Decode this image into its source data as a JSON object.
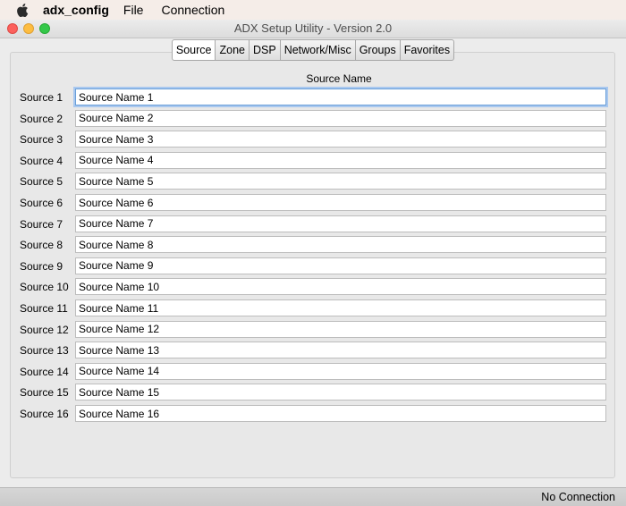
{
  "menubar": {
    "app_name": "adx_config",
    "items": [
      "File",
      "Connection"
    ]
  },
  "window": {
    "title": "ADX Setup Utility - Version 2.0"
  },
  "tabs": [
    {
      "label": "Source",
      "active": true
    },
    {
      "label": "Zone",
      "active": false
    },
    {
      "label": "DSP",
      "active": false
    },
    {
      "label": "Network/Misc",
      "active": false
    },
    {
      "label": "Groups",
      "active": false
    },
    {
      "label": "Favorites",
      "active": false
    }
  ],
  "table": {
    "column_header": "Source Name",
    "rows": [
      {
        "label": "Source 1",
        "value": "Source Name 1"
      },
      {
        "label": "Source 2",
        "value": "Source Name 2"
      },
      {
        "label": "Source 3",
        "value": "Source Name 3"
      },
      {
        "label": "Source 4",
        "value": "Source Name 4"
      },
      {
        "label": "Source 5",
        "value": "Source Name 5"
      },
      {
        "label": "Source 6",
        "value": "Source Name 6"
      },
      {
        "label": "Source 7",
        "value": "Source Name 7"
      },
      {
        "label": "Source 8",
        "value": "Source Name 8"
      },
      {
        "label": "Source 9",
        "value": "Source Name 9"
      },
      {
        "label": "Source 10",
        "value": "Source Name 10"
      },
      {
        "label": "Source 11",
        "value": "Source Name 11"
      },
      {
        "label": "Source 12",
        "value": "Source Name 12"
      },
      {
        "label": "Source 13",
        "value": "Source Name 13"
      },
      {
        "label": "Source 14",
        "value": "Source Name 14"
      },
      {
        "label": "Source 15",
        "value": "Source Name 15"
      },
      {
        "label": "Source 16",
        "value": "Source Name 16"
      }
    ]
  },
  "status": {
    "text": "No Connection"
  }
}
